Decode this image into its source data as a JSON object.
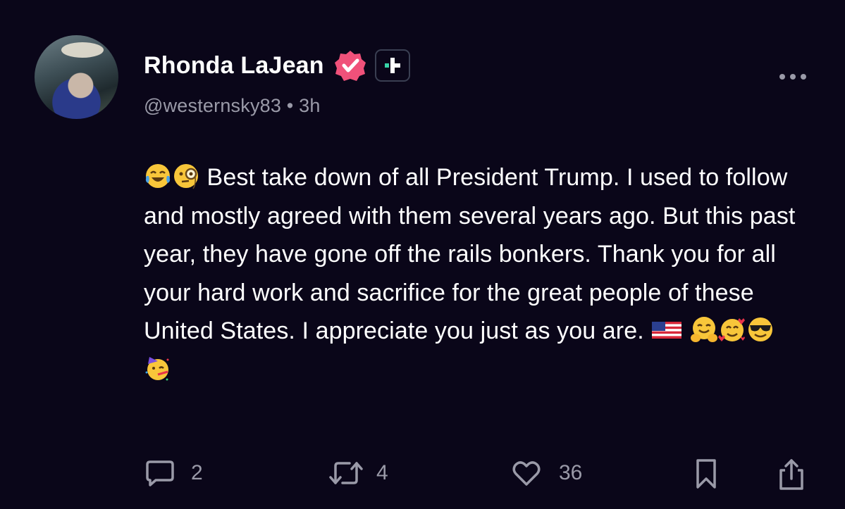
{
  "post": {
    "author": {
      "display_name": "Rhonda LaJean",
      "handle": "@westernsky83",
      "time_ago": "3h",
      "verified": true,
      "verified_color": "#f0517a",
      "avatar_icon": "profile-photo"
    },
    "text_segments": {
      "line_start": "Best take down of all President Trump. I used to follow and mostly agreed with them several years ago. But this past year, they have gone off the rails bonkers. Thank you for all your hard work and sacrifice for the great people of these United States. I appreciate you just as you are."
    },
    "emojis": {
      "leading": [
        "face-with-tears-of-joy",
        "face-with-monocle"
      ],
      "trailing": [
        "us-flag",
        "hugging-face",
        "smiling-face-with-hearts",
        "smiling-face-with-sunglasses",
        "partying-face"
      ]
    },
    "actions": {
      "replies": "2",
      "reposts": "4",
      "likes": "36"
    },
    "colors": {
      "background": "#0a0619",
      "text": "#ffffff",
      "muted": "#9a9aa8",
      "plus_accent": "#37d4a7"
    }
  }
}
